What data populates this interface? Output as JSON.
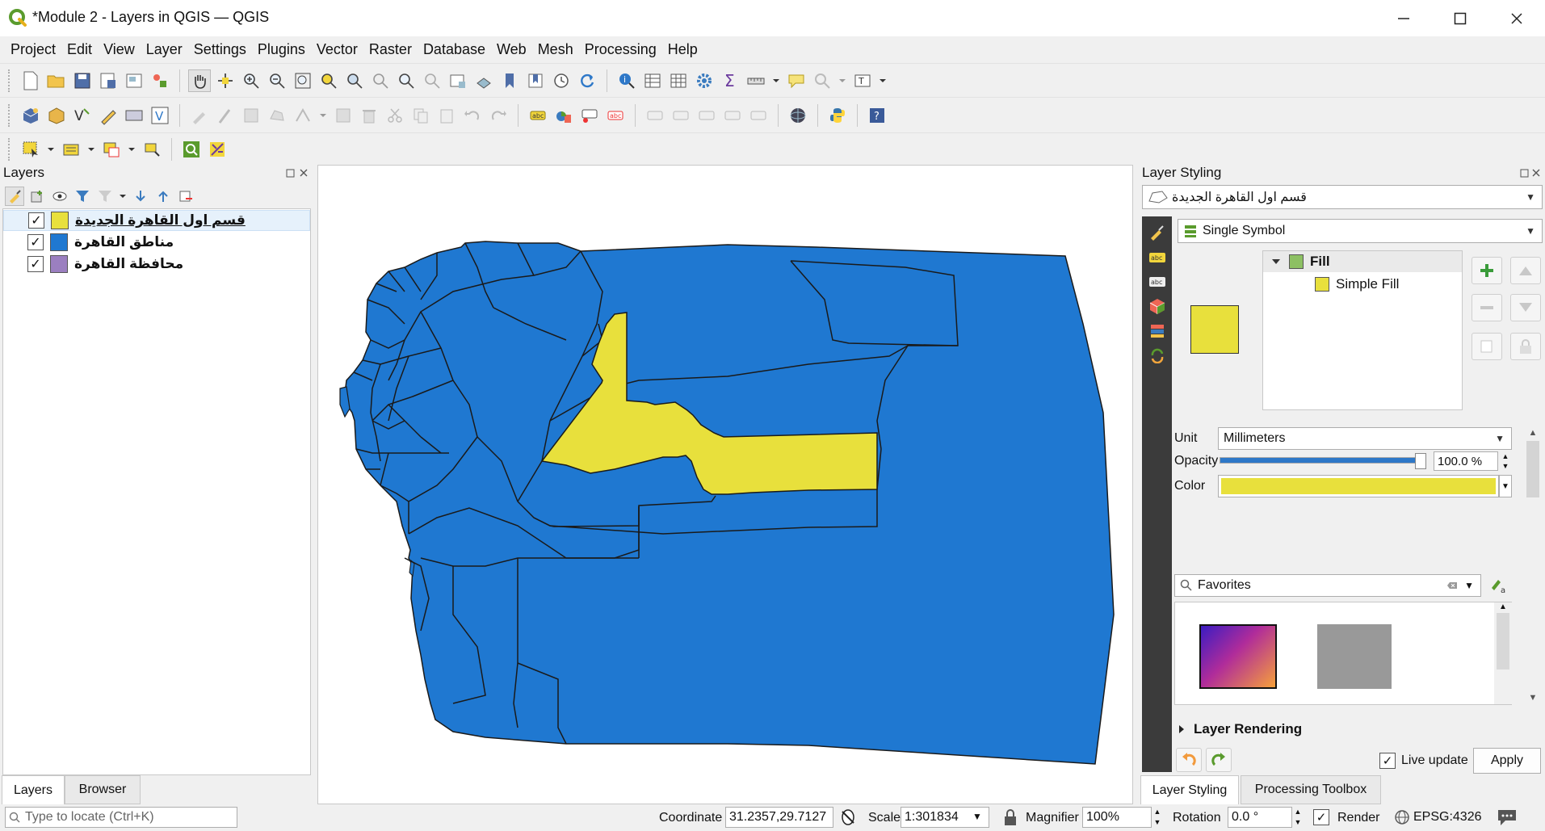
{
  "window": {
    "title": "*Module 2 - Layers in QGIS — QGIS",
    "minimize_glyph": "—",
    "maximize_glyph": "☐",
    "close_glyph": "✕"
  },
  "menu": [
    "Project",
    "Edit",
    "View",
    "Layer",
    "Settings",
    "Plugins",
    "Vector",
    "Raster",
    "Database",
    "Web",
    "Mesh",
    "Processing",
    "Help"
  ],
  "layers_panel": {
    "title": "Layers",
    "items": [
      {
        "label": "قسم اول القاهرة الجديدة",
        "checked": "✓",
        "color": "#e8e03c",
        "selected": true
      },
      {
        "label": "مناطق القاهرة",
        "checked": "✓",
        "color": "#1f78d1",
        "selected": false
      },
      {
        "label": "محافظة القاهرة",
        "checked": "✓",
        "color": "#9b7fc0",
        "selected": false
      }
    ],
    "tabs": [
      "Layers",
      "Browser"
    ]
  },
  "styling_panel": {
    "title": "Layer Styling",
    "layer_select": "قسم اول القاهرة الجديدة",
    "renderer": "Single Symbol",
    "tree": {
      "fill": "Fill",
      "simple_fill": "Simple Fill"
    },
    "unit_label": "Unit",
    "unit_value": "Millimeters",
    "opacity_label": "Opacity",
    "opacity_value": "100.0 %",
    "opacity_fraction": 1.0,
    "color_label": "Color",
    "fill_color": "#e8e03c",
    "search_placeholder": "Favorites",
    "layer_rendering": "Layer Rendering",
    "live_update": "Live update",
    "live_update_checked": "✓",
    "apply": "Apply",
    "tabs": [
      "Layer Styling",
      "Processing Toolbox"
    ]
  },
  "statusbar": {
    "locate_placeholder": "Type to locate (Ctrl+K)",
    "coordinate_label": "Coordinate",
    "coordinate_value": "31.2357,29.7127",
    "scale_label": "Scale",
    "scale_value": "1:301834",
    "magnifier_label": "Magnifier",
    "magnifier_value": "100%",
    "rotation_label": "Rotation",
    "rotation_value": "0.0 °",
    "render_label": "Render",
    "render_checked": "✓",
    "crs": "EPSG:4326"
  },
  "colors": {
    "region_blue": "#1f78d1",
    "highlight_yellow": "#e8e03c",
    "outline": "#1a1a1a"
  }
}
